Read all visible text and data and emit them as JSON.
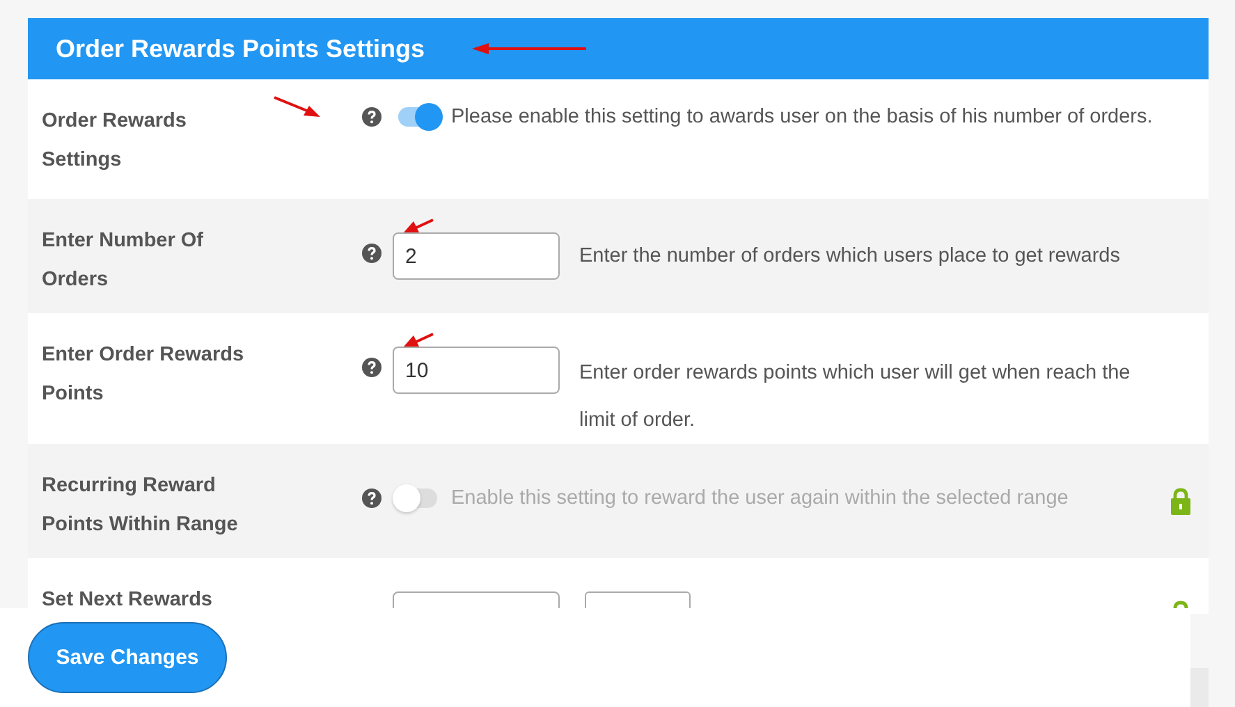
{
  "panel": {
    "title": "Order Rewards Points Settings"
  },
  "rows": [
    {
      "label": "Order Rewards Settings",
      "kind": "toggle",
      "on": true,
      "locked": false,
      "description": "Please enable this setting to awards user on the basis of his number of orders."
    },
    {
      "label": "Enter Number Of Orders",
      "kind": "number",
      "value": "2",
      "locked": false,
      "description": "Enter the number of orders which users place to get rewards"
    },
    {
      "label": "Enter Order Rewards Points",
      "kind": "number",
      "value": "10",
      "locked": false,
      "description": "Enter order rewards points which user will get when reach the limit of order."
    },
    {
      "label": "Recurring Reward Points Within Range",
      "kind": "toggle",
      "on": false,
      "locked": true,
      "description": "Enable this setting to reward the user again within the selected range"
    },
    {
      "label": "Set Next Rewards",
      "kind": "range",
      "locked": true
    }
  ],
  "save_button": "Save Changes"
}
